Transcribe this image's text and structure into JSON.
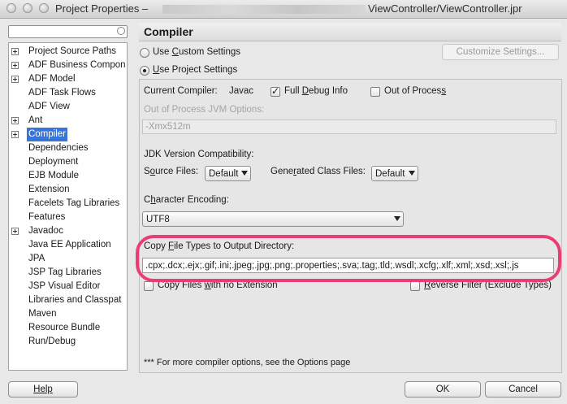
{
  "window": {
    "title_prefix": "Project Properties –",
    "title_suffix": "ViewController/ViewController.jpr"
  },
  "tree": {
    "items": [
      {
        "label": "Project Source Paths",
        "expandable": true
      },
      {
        "label": "ADF Business Compon",
        "expandable": true
      },
      {
        "label": "ADF Model",
        "expandable": true
      },
      {
        "label": "ADF Task Flows",
        "expandable": false
      },
      {
        "label": "ADF View",
        "expandable": false
      },
      {
        "label": "Ant",
        "expandable": true
      },
      {
        "label": "Compiler",
        "expandable": true,
        "selected": true
      },
      {
        "label": "Dependencies",
        "expandable": false
      },
      {
        "label": "Deployment",
        "expandable": false
      },
      {
        "label": "EJB Module",
        "expandable": false
      },
      {
        "label": "Extension",
        "expandable": false
      },
      {
        "label": "Facelets Tag Libraries",
        "expandable": false
      },
      {
        "label": "Features",
        "expandable": false
      },
      {
        "label": "Javadoc",
        "expandable": true
      },
      {
        "label": "Java EE Application",
        "expandable": false
      },
      {
        "label": "JPA",
        "expandable": false
      },
      {
        "label": "JSP Tag Libraries",
        "expandable": false
      },
      {
        "label": "JSP Visual Editor",
        "expandable": false
      },
      {
        "label": "Libraries and Classpat",
        "expandable": false
      },
      {
        "label": "Maven",
        "expandable": false
      },
      {
        "label": "Resource Bundle",
        "expandable": false
      },
      {
        "label": "Run/Debug",
        "expandable": false
      }
    ]
  },
  "panel": {
    "header": "Compiler",
    "use_custom_pre": "Use ",
    "use_custom_u": "C",
    "use_custom_post": "ustom Settings",
    "use_project_pre": "",
    "use_project_u": "U",
    "use_project_post": "se Project Settings",
    "customize_button": "Customize Settings...",
    "current_compiler_label": "Current Compiler:",
    "current_compiler_value": "Javac",
    "full_debug_pre": "Full ",
    "full_debug_u": "D",
    "full_debug_post": "ebug Info",
    "out_of_process_pre": "Out of Proces",
    "out_of_process_u": "s",
    "out_of_process_post": "",
    "oop_jvm_label": "Out of Process JVM Options:",
    "oop_jvm_value": "-Xmx512m",
    "jdk_compat_label": "JDK Version Compatibility:",
    "source_files_pre": "S",
    "source_files_u": "o",
    "source_files_post": "urce Files:",
    "source_files_value": "Default",
    "generated_pre": "Gene",
    "generated_u": "r",
    "generated_post": "ated Class Files:",
    "generated_value": "Default",
    "encoding_pre": "C",
    "encoding_u": "h",
    "encoding_post": "aracter Encoding:",
    "encoding_value": "UTF8",
    "copy_types_pre": "Copy ",
    "copy_types_u": "F",
    "copy_types_post": "ile Types to Output Directory:",
    "copy_types_value": ".cpx;.dcx;.ejx;.gif;.ini;.jpeg;.jpg;.png;.properties;.sva;.tag;.tld;.wsdl;.xcfg;.xlf;.xml;.xsd;.xsl;.js",
    "copy_no_ext_pre": "Copy Files ",
    "copy_no_ext_u": "w",
    "copy_no_ext_post": "ith no Extension",
    "reverse_filter_pre": "",
    "reverse_filter_u": "R",
    "reverse_filter_post": "everse Filter (Exclude Types)",
    "footer_note": "*** For more compiler options, see the Options page"
  },
  "buttons": {
    "help": "Help",
    "ok": "OK",
    "cancel": "Cancel"
  },
  "colors": {
    "selection": "#3875d7",
    "highlight_ring": "#ea3e72"
  }
}
